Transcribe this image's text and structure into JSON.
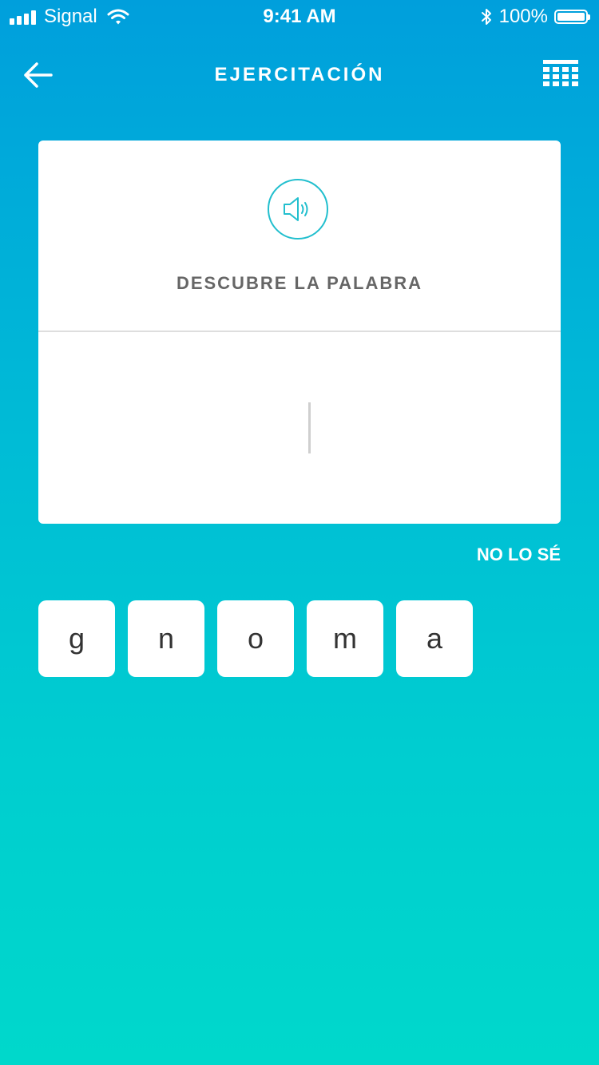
{
  "status_bar": {
    "carrier": "Signal",
    "time": "9:41 AM",
    "battery": "100%"
  },
  "nav": {
    "title": "EJERCITACIÓN",
    "back_icon": "arrow-left-icon",
    "keyboard_icon": "keyboard-icon"
  },
  "card": {
    "speaker_icon": "speaker-icon",
    "prompt": "DESCUBRE LA PALABRA",
    "answer": ""
  },
  "dont_know_label": "NO LO SÉ",
  "letters": [
    "g",
    "n",
    "o",
    "m",
    "a"
  ],
  "colors": {
    "accent": "#22bfce",
    "gradient_top": "#009fdc",
    "gradient_bottom": "#00d8cb"
  }
}
